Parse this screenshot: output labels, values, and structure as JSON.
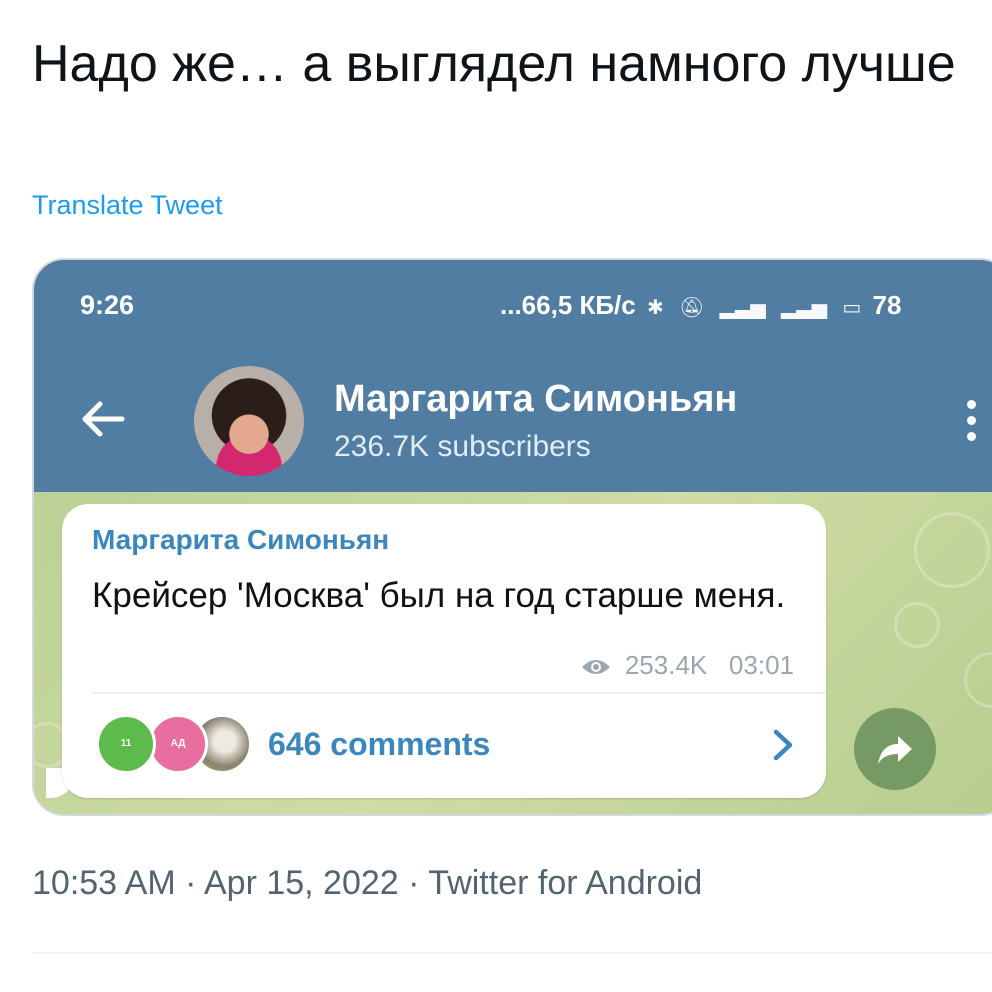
{
  "tweet": {
    "text": "Надо же… а выглядел намного лучше",
    "translate_label": "Translate Tweet",
    "timestamp": "10:53 AM · Apr 15, 2022 · Twitter for Android"
  },
  "media": {
    "status_bar": {
      "time": "9:26",
      "network": "...66,5 КБ/с",
      "battery": "78"
    },
    "header": {
      "channel_name": "Маргарита Симоньян",
      "subscribers": "236.7K subscribers"
    },
    "post": {
      "author": "Маргарита Симоньян",
      "text": "Крейсер 'Москва' был на год старше меня.",
      "views": "253.4K",
      "time": "03:01",
      "comments_label": "646 comments",
      "commenter_avatars": [
        {
          "initials": "11",
          "color": "#5cbb4c"
        },
        {
          "initials": "АД",
          "color": "#e96ea0"
        },
        {
          "initials": "",
          "color": "#a8a08a"
        }
      ]
    },
    "colors": {
      "header": "#517da2",
      "accent": "#3a86bf",
      "link": "#1d9bf0"
    }
  }
}
